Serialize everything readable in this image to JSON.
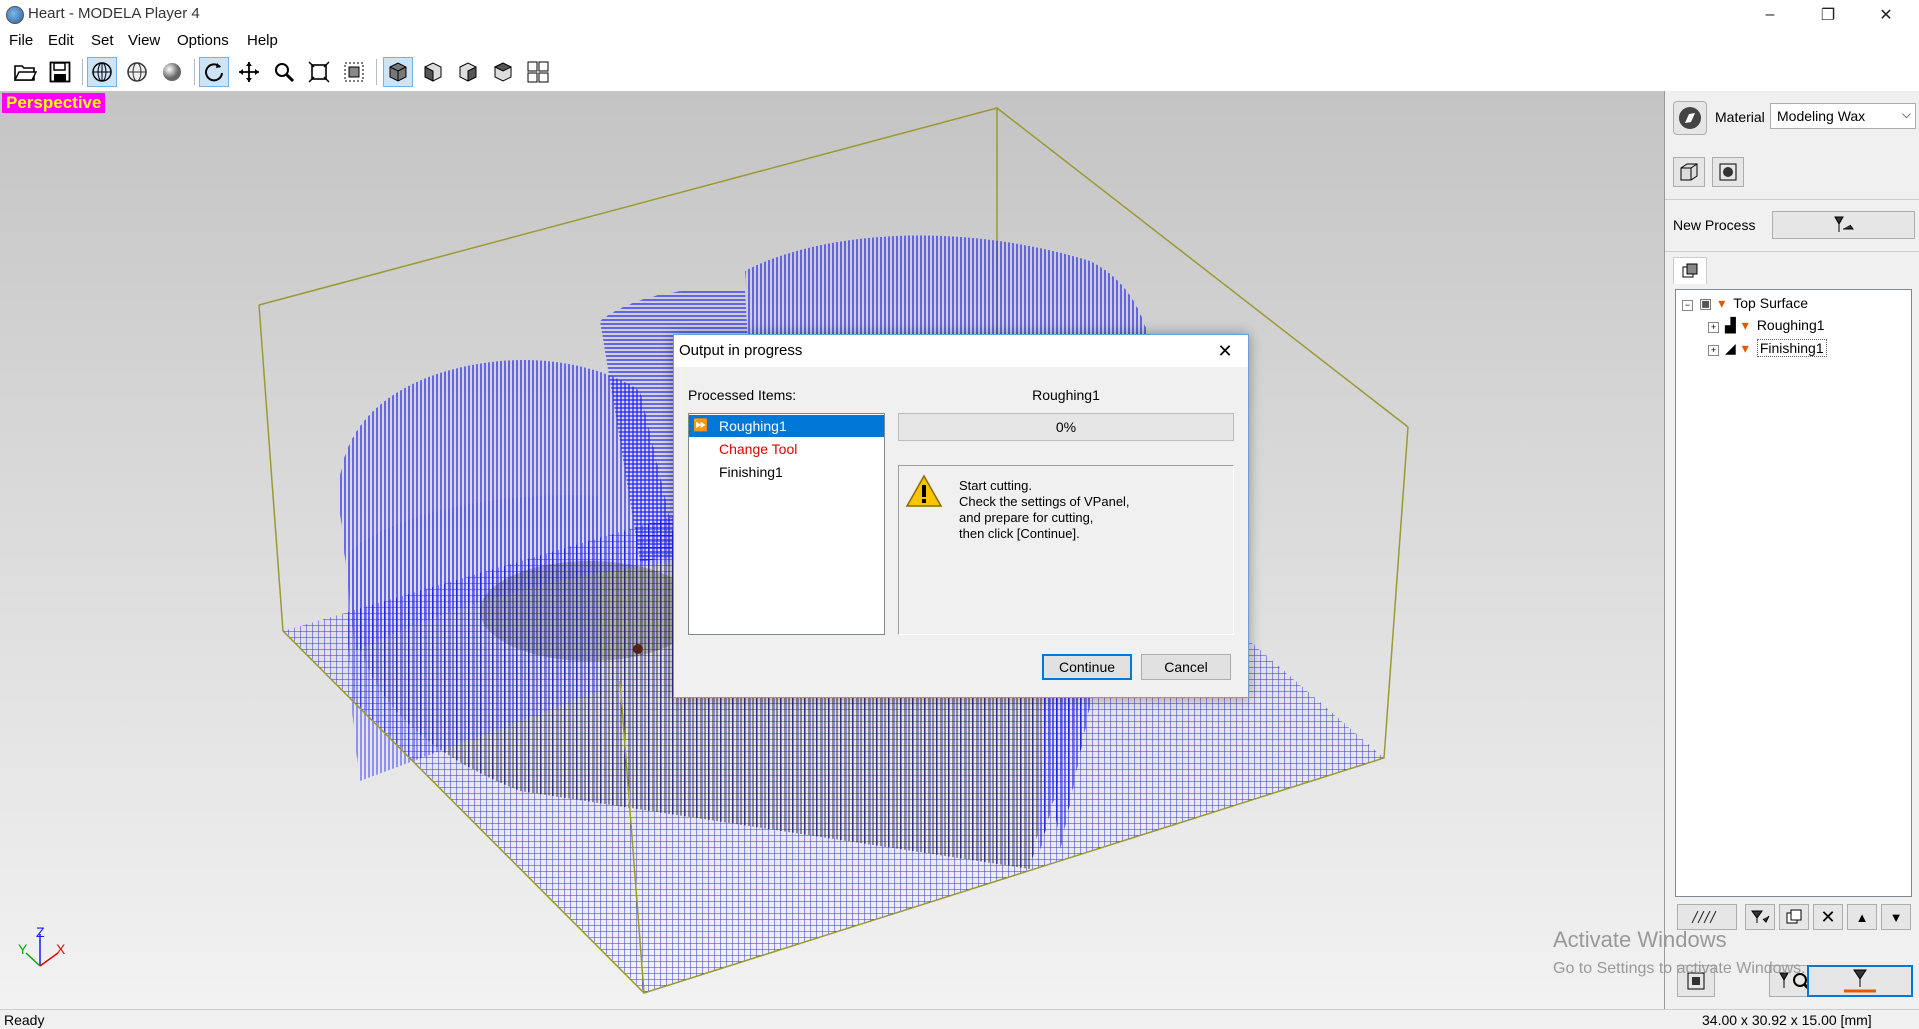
{
  "window": {
    "title": "Heart - MODELA Player 4",
    "minimize": "–",
    "maximize": "❐",
    "close": "✕"
  },
  "menu": [
    "File",
    "Edit",
    "Set",
    "View",
    "Options",
    "Help"
  ],
  "toolbar": {
    "icons": [
      "open-icon",
      "save-icon",
      "wireframe-view-icon",
      "hidden-line-view-icon",
      "shaded-view-icon",
      "rotate-icon",
      "pan-icon",
      "zoom-icon",
      "fit-all-icon",
      "zoom-window-icon",
      "view-perspective-icon",
      "view-front-icon",
      "view-right-icon",
      "view-top-icon",
      "view-four-icon"
    ]
  },
  "viewport": {
    "label": "Perspective",
    "axes": {
      "x": "X",
      "y": "Y",
      "z": "Z"
    }
  },
  "panel": {
    "material_label": "Material",
    "material_value": "Modeling Wax",
    "new_process_label": "New Process",
    "tree": {
      "root": "Top Surface",
      "children": [
        "Roughing1",
        "Finishing1"
      ]
    }
  },
  "watermark": {
    "line1": "Activate Windows",
    "line2": "Go to Settings to activate Windows."
  },
  "status": {
    "left": "Ready",
    "right": "34.00 x 30.92 x 15.00 [mm]"
  },
  "dialog": {
    "title": "Output in progress",
    "processed_label": "Processed Items:",
    "items": [
      {
        "label": "Roughing1",
        "state": "selected"
      },
      {
        "label": "Change Tool",
        "state": "warning"
      },
      {
        "label": "Finishing1",
        "state": "normal"
      }
    ],
    "current_item": "Roughing1",
    "progress_text": "0%",
    "progress_value": 0,
    "message_lines": [
      "Start cutting.",
      "Check the settings of VPanel,",
      "and prepare for cutting,",
      "then click [Continue]."
    ],
    "continue_label": "Continue",
    "cancel_label": "Cancel"
  },
  "colors": {
    "toolpath": "#1a1aff",
    "box_outline": "#9a9a33",
    "perspective_bg": "#ff00ff",
    "perspective_fg": "#ffff00",
    "selection": "#0078d7",
    "warning_text": "#e00000"
  }
}
